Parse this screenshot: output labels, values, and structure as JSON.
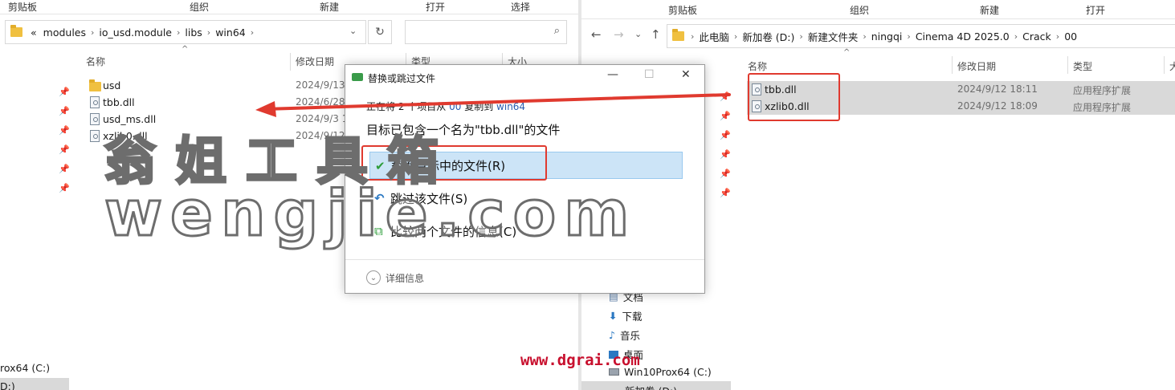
{
  "left": {
    "ribbon": [
      "剪贴板",
      "组织",
      "新建",
      "打开",
      "选择"
    ],
    "breadcrumb": [
      "«",
      "modules",
      "io_usd.module",
      "libs",
      "win64"
    ],
    "columns": {
      "name": "名称",
      "date": "修改日期",
      "type": "类型",
      "size": "大小"
    },
    "files": [
      {
        "name": "usd",
        "date": "2024/9/13",
        "kind": "folder"
      },
      {
        "name": "tbb.dll",
        "date": "2024/6/28",
        "kind": "dll"
      },
      {
        "name": "usd_ms.dll",
        "date": "2024/9/3 1",
        "kind": "dll"
      },
      {
        "name": "xzlib0.dll",
        "date": "2024/9/12",
        "kind": "dll"
      }
    ],
    "drives": [
      "rox64 (C:)",
      "D:)"
    ]
  },
  "dialog": {
    "title": "替换或跳过文件",
    "progress_prefix": "正在将 2 个项目从",
    "progress_from": "00",
    "progress_mid": "复制到",
    "progress_to": "win64",
    "message": "目标已包含一个名为\"tbb.dll\"的文件",
    "options": {
      "replace": "替换目标中的文件(R)",
      "skip": "跳过该文件(S)",
      "compare": "比较两个文件的信息(C)"
    },
    "details": "详细信息",
    "controls": {
      "minimize": "—",
      "maximize": "☐",
      "close": "✕"
    }
  },
  "right": {
    "ribbon": [
      "剪贴板",
      "组织",
      "新建",
      "打开"
    ],
    "breadcrumb": [
      "此电脑",
      "新加卷 (D:)",
      "新建文件夹",
      "ningqi",
      "Cinema 4D 2025.0",
      "Crack",
      "00"
    ],
    "columns": {
      "name": "名称",
      "date": "修改日期",
      "type": "类型",
      "size": "大"
    },
    "files": [
      {
        "name": "tbb.dll",
        "date": "2024/9/12 18:11",
        "type": "应用程序扩展"
      },
      {
        "name": "xzlib0.dll",
        "date": "2024/9/12 18:09",
        "type": "应用程序扩展"
      }
    ],
    "tree": [
      "文档",
      "下载",
      "音乐",
      "桌面",
      "Win10Prox64 (C:)",
      "新加卷 (D:)"
    ]
  },
  "watermark": {
    "chinese": "翁姐工具箱",
    "latin": "wengjie.com",
    "site": "www.dgrai.com"
  },
  "colors": {
    "annotation_red": "#e03a2f",
    "selection_blue": "#cce4f7",
    "site_red": "#c8102e"
  }
}
